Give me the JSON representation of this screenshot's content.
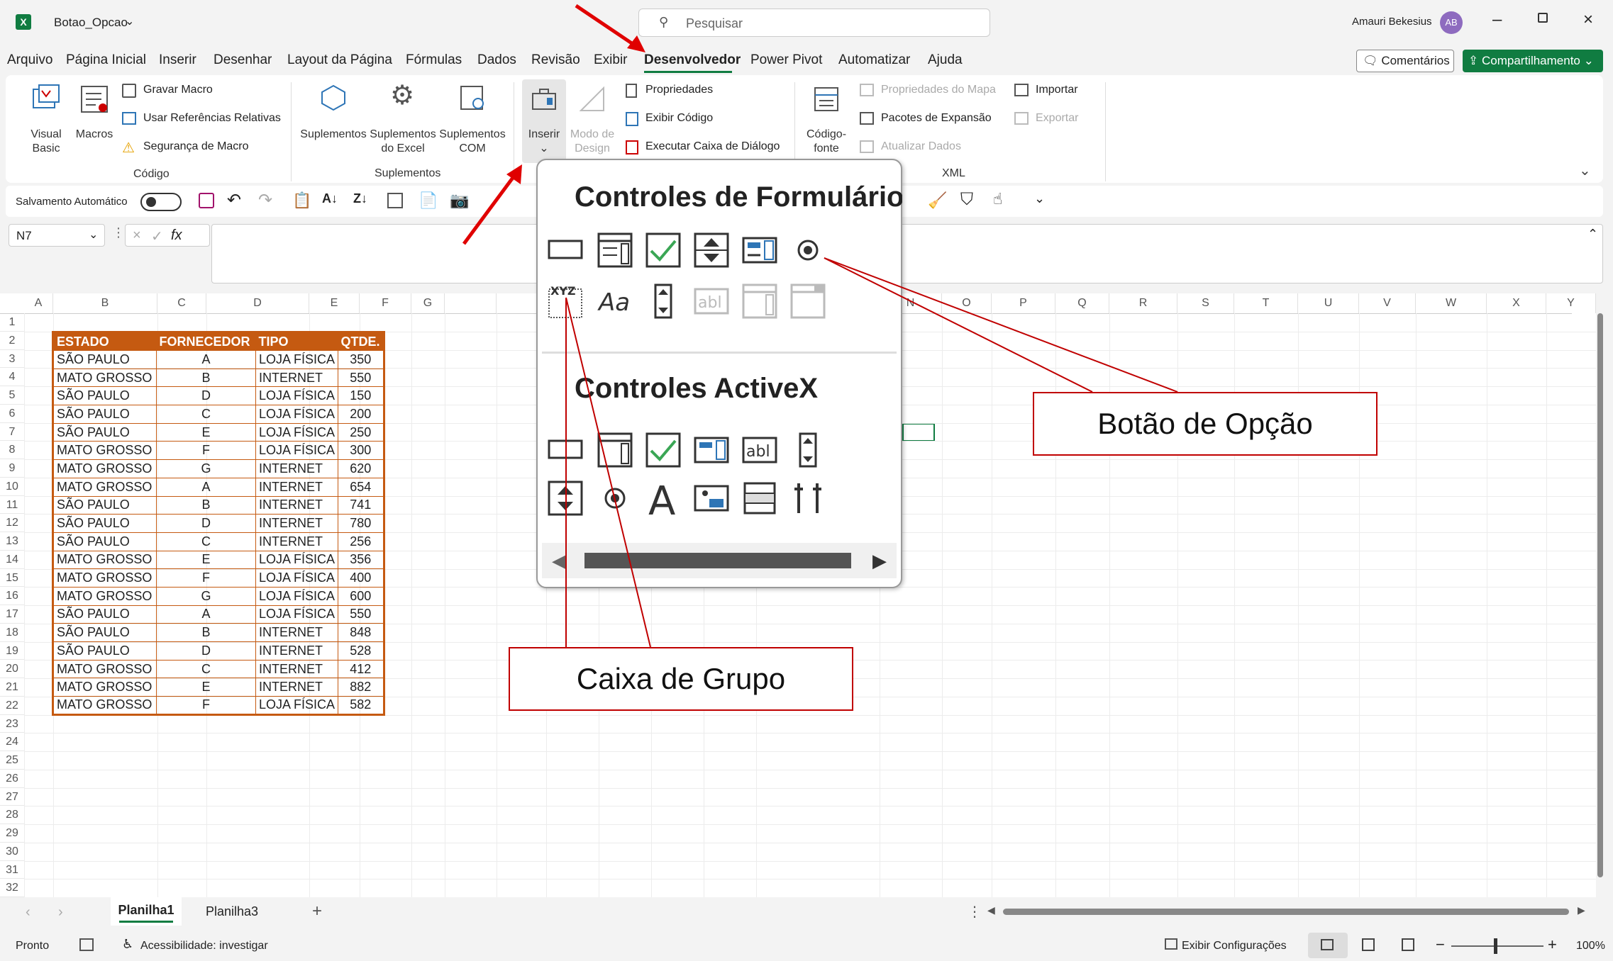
{
  "title": {
    "filename": "Botao_Opcao",
    "search_placeholder": "Pesquisar",
    "user": "Amauri Bekesius",
    "user_initials": "AB"
  },
  "menu": [
    "Arquivo",
    "Página Inicial",
    "Inserir",
    "Desenhar",
    "Layout da Página",
    "Fórmulas",
    "Dados",
    "Revisão",
    "Exibir",
    "Desenvolvedor",
    "Power Pivot",
    "Automatizar",
    "Ajuda"
  ],
  "menu_active": "Desenvolvedor",
  "menu_right": {
    "comments": "Comentários",
    "share": "Compartilhamento"
  },
  "ribbon": {
    "codigo": {
      "visual_basic": "Visual Basic",
      "macros": "Macros",
      "gravar": "Gravar Macro",
      "referencias": "Usar Referências Relativas",
      "seguranca": "Segurança de Macro",
      "label": "Código"
    },
    "suplementos": {
      "sup1": "Suplementos",
      "sup2": "Suplementos do Excel",
      "sup3": "Suplementos COM",
      "label": "Suplementos"
    },
    "controles": {
      "inserir": "Inserir",
      "modo": "Modo de Design",
      "propriedades": "Propriedades",
      "exibir_codigo": "Exibir Código",
      "executar": "Executar Caixa de Diálogo"
    },
    "xml": {
      "codigo_fonte": "Código-fonte",
      "propriedades_mapa": "Propriedades do Mapa",
      "pacotes": "Pacotes de Expansão",
      "atualizar": "Atualizar Dados",
      "importar": "Importar",
      "exportar": "Exportar",
      "label": "XML"
    }
  },
  "qat": {
    "autosave": "Salvamento Automático"
  },
  "namebox": "N7",
  "columns": [
    "A",
    "B",
    "C",
    "D",
    "E",
    "F",
    "G",
    "",
    "",
    "",
    "",
    "",
    "",
    "",
    "N",
    "O",
    "P",
    "Q",
    "R",
    "S",
    "T",
    "U",
    "V",
    "W",
    "X",
    "Y"
  ],
  "rows": [
    "1",
    "2",
    "3",
    "4",
    "5",
    "6",
    "7",
    "8",
    "9",
    "10",
    "11",
    "12",
    "13",
    "14",
    "15",
    "16",
    "17",
    "18",
    "19",
    "20",
    "21",
    "22",
    "23",
    "24",
    "25",
    "26",
    "27",
    "28",
    "29",
    "30",
    "31",
    "32"
  ],
  "table": {
    "headers": [
      "ESTADO",
      "FORNECEDOR",
      "TIPO",
      "QTDE."
    ],
    "rows": [
      [
        "SÃO PAULO",
        "A",
        "LOJA FÍSICA",
        "350"
      ],
      [
        "MATO GROSSO",
        "B",
        "INTERNET",
        "550"
      ],
      [
        "SÃO PAULO",
        "D",
        "LOJA FÍSICA",
        "150"
      ],
      [
        "SÃO PAULO",
        "C",
        "LOJA FÍSICA",
        "200"
      ],
      [
        "SÃO PAULO",
        "E",
        "LOJA FÍSICA",
        "250"
      ],
      [
        "MATO GROSSO",
        "F",
        "LOJA FÍSICA",
        "300"
      ],
      [
        "MATO GROSSO",
        "G",
        "INTERNET",
        "620"
      ],
      [
        "MATO GROSSO",
        "A",
        "INTERNET",
        "654"
      ],
      [
        "SÃO PAULO",
        "B",
        "INTERNET",
        "741"
      ],
      [
        "SÃO PAULO",
        "D",
        "INTERNET",
        "780"
      ],
      [
        "SÃO PAULO",
        "C",
        "INTERNET",
        "256"
      ],
      [
        "MATO GROSSO",
        "E",
        "LOJA FÍSICA",
        "356"
      ],
      [
        "MATO GROSSO",
        "F",
        "LOJA FÍSICA",
        "400"
      ],
      [
        "MATO GROSSO",
        "G",
        "LOJA FÍSICA",
        "600"
      ],
      [
        "SÃO PAULO",
        "A",
        "LOJA FÍSICA",
        "550"
      ],
      [
        "SÃO PAULO",
        "B",
        "INTERNET",
        "848"
      ],
      [
        "SÃO PAULO",
        "D",
        "INTERNET",
        "528"
      ],
      [
        "MATO GROSSO",
        "C",
        "INTERNET",
        "412"
      ],
      [
        "MATO GROSSO",
        "E",
        "INTERNET",
        "882"
      ],
      [
        "MATO GROSSO",
        "F",
        "LOJA FÍSICA",
        "582"
      ]
    ]
  },
  "popup": {
    "form_title": "Controles de Formulário",
    "activex_title": "Controles ActiveX"
  },
  "callouts": {
    "option_button": "Botão de Opção",
    "group_box": "Caixa de Grupo"
  },
  "sheets": [
    "Planilha1",
    "Planilha3"
  ],
  "active_sheet": "Planilha1",
  "status": {
    "ready": "Pronto",
    "accessibility": "Acessibilidade: investigar",
    "display": "Exibir Configurações",
    "zoom": "100%"
  },
  "colors": {
    "excel_green": "#107c41",
    "table_orange": "#c55a11",
    "annotation_red": "#c00000",
    "avatar": "#8e6bbf"
  }
}
